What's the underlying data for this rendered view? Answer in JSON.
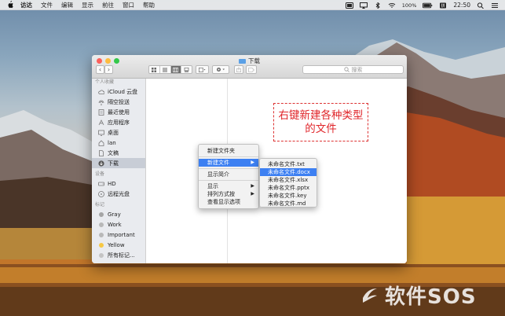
{
  "menubar": {
    "app_name": "访达",
    "items": [
      "文件",
      "编辑",
      "显示",
      "前往",
      "窗口",
      "帮助"
    ],
    "battery": "100%",
    "time": "22:50"
  },
  "window": {
    "title": "下载",
    "search_placeholder": "搜索"
  },
  "sidebar": {
    "favorites_header": "个人收藏",
    "favorites": [
      "iCloud 云盘",
      "隔空投送",
      "最近使用",
      "应用程序",
      "桌面",
      "lan",
      "文稿",
      "下载"
    ],
    "selected": "下载",
    "devices_header": "设备",
    "devices": [
      "HD",
      "远程光盘"
    ],
    "tags_header": "标记",
    "tags": [
      {
        "label": "Gray",
        "color": "#a5a5a5"
      },
      {
        "label": "Work",
        "color": "#b8b8b8"
      },
      {
        "label": "Important",
        "color": "#b8b8b8"
      },
      {
        "label": "Yellow",
        "color": "#f7c843"
      },
      {
        "label": "所有标记...",
        "color": "#c4c4c4"
      }
    ]
  },
  "annotation": {
    "line1": "右键新建各种类型",
    "line2": "的文件",
    "color": "#e0262b"
  },
  "context_menu": {
    "items": [
      "新建文件夹",
      "新建文件",
      "显示简介",
      "显示",
      "排列方式按",
      "查看显示选项"
    ],
    "highlighted": "新建文件"
  },
  "submenu": {
    "items": [
      "未命名文件.txt",
      "未命名文件.docx",
      "未命名文件.xlsx",
      "未命名文件.pptx",
      "未命名文件.key",
      "未命名文件.md"
    ],
    "highlighted": "未命名文件.docx"
  },
  "watermark": {
    "text": "软件SOS"
  }
}
